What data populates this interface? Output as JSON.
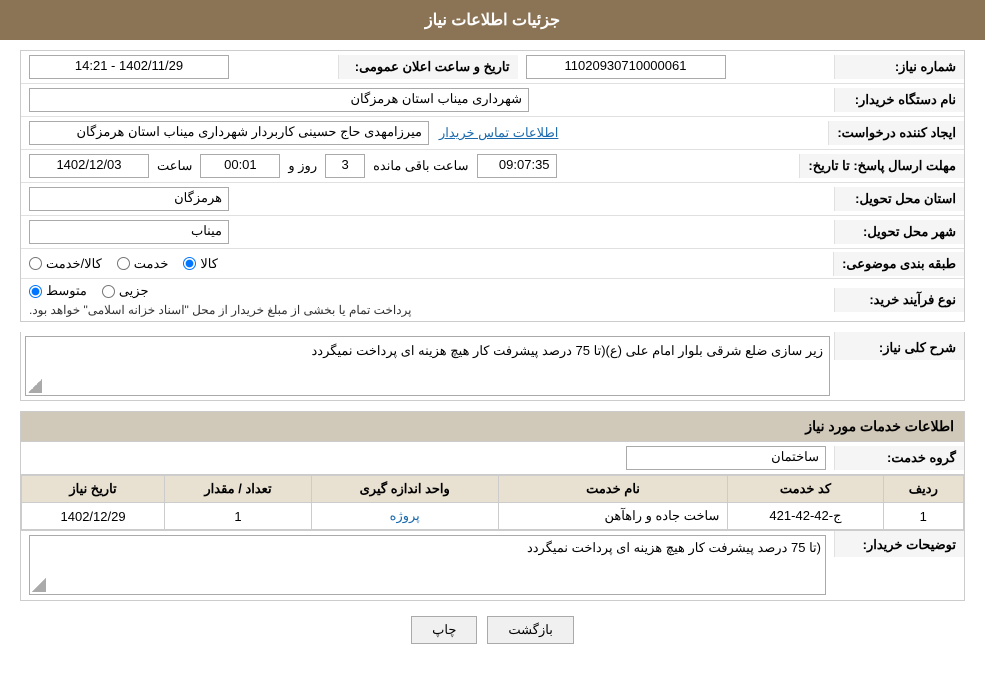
{
  "header": {
    "title": "جزئیات اطلاعات نیاز"
  },
  "form": {
    "need_number_label": "شماره نیاز:",
    "need_number_value": "11020930710000061",
    "date_announce_label": "تاریخ و ساعت اعلان عمومی:",
    "date_announce_value": "1402/11/29 - 14:21",
    "buyer_org_label": "نام دستگاه خریدار:",
    "buyer_org_value": "شهرداری میناب استان هرمزگان",
    "creator_label": "ایجاد کننده درخواست:",
    "creator_value": "میرزامهدی حاج حسینی کاربردار شهرداری میناب استان هرمزگان",
    "contact_info_link": "اطلاعات تماس خریدار",
    "deadline_label": "مهلت ارسال پاسخ: تا تاریخ:",
    "deadline_date": "1402/12/03",
    "deadline_time_label": "ساعت",
    "deadline_time": "00:01",
    "deadline_days_label": "روز و",
    "deadline_days": "3",
    "deadline_remaining_label": "ساعت باقی مانده",
    "deadline_remaining": "09:07:35",
    "province_label": "استان محل تحویل:",
    "province_value": "هرمزگان",
    "city_label": "شهر محل تحویل:",
    "city_value": "میناب",
    "category_label": "طبقه بندی موضوعی:",
    "category_options": [
      "کالا",
      "خدمت",
      "کالا/خدمت"
    ],
    "category_selected": "کالا",
    "purchase_type_label": "نوع فرآیند خرید:",
    "purchase_options": [
      "جزیی",
      "متوسط"
    ],
    "purchase_selected": "متوسط",
    "purchase_note": "پرداخت تمام یا بخشی از مبلغ خریدار از محل \"اسناد خزانه اسلامی\" خواهد بود.",
    "description_label": "شرح کلی نیاز:",
    "description_value": "زیر سازی ضلع شرقی بلوار امام علی (ع)(تا 75 درصد پیشرفت کار هیچ هزینه ای پرداخت نمیگردد",
    "services_info_title": "اطلاعات خدمات مورد نیاز",
    "service_group_label": "گروه خدمت:",
    "service_group_value": "ساختمان",
    "table": {
      "headers": [
        "ردیف",
        "کد خدمت",
        "نام خدمت",
        "واحد اندازه گیری",
        "تعداد / مقدار",
        "تاریخ نیاز"
      ],
      "rows": [
        {
          "row_num": "1",
          "service_code": "ج-42-42-421",
          "service_name": "ساخت جاده و راهآهن",
          "unit": "پروژه",
          "qty": "1",
          "date": "1402/12/29"
        }
      ]
    },
    "buyer_desc_label": "توضیحات خریدار:",
    "buyer_desc_value": "(تا 75 درصد پیشرفت کار هیچ هزینه ای پرداخت نمیگردد"
  },
  "buttons": {
    "print_label": "چاپ",
    "back_label": "بازگشت"
  },
  "colors": {
    "header_bg": "#8B7355",
    "section_title_bg": "#d0c8b8",
    "table_header_bg": "#e8e0d0"
  }
}
